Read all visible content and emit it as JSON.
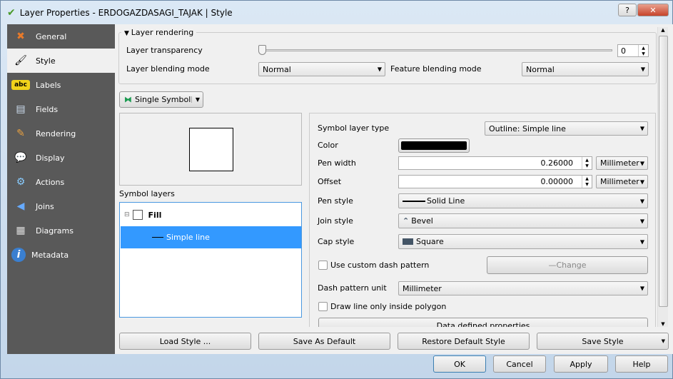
{
  "window": {
    "title": "Layer Properties - ERDOGAZDASAGI_TAJAK | Style",
    "help": "?",
    "close": "✕"
  },
  "sidebar": {
    "items": [
      {
        "label": "General",
        "icon": "wrench-screwdriver-icon",
        "glyph": "✖"
      },
      {
        "label": "Style",
        "icon": "paintbrush-icon",
        "glyph": "🖌"
      },
      {
        "label": "Labels",
        "icon": "abc-label-icon",
        "glyph": "abc"
      },
      {
        "label": "Fields",
        "icon": "table-icon",
        "glyph": "▤"
      },
      {
        "label": "Rendering",
        "icon": "brush-icon",
        "glyph": "✎"
      },
      {
        "label": "Display",
        "icon": "speech-bubble-icon",
        "glyph": "💬"
      },
      {
        "label": "Actions",
        "icon": "gear-icon",
        "glyph": "⚙"
      },
      {
        "label": "Joins",
        "icon": "join-icon",
        "glyph": "◀"
      },
      {
        "label": "Diagrams",
        "icon": "chart-icon",
        "glyph": "▦"
      },
      {
        "label": "Metadata",
        "icon": "info-icon",
        "glyph": "i"
      }
    ]
  },
  "rendering": {
    "title": "Layer rendering",
    "transparency_label": "Layer transparency",
    "transparency_value": "0",
    "transparency_percent": 0,
    "blend_label": "Layer blending mode",
    "blend_value": "Normal",
    "feature_blend_label": "Feature blending mode",
    "feature_blend_value": "Normal"
  },
  "renderer": {
    "value": "Single Symbol"
  },
  "symbol_layers": {
    "label": "Symbol layers",
    "items": [
      {
        "label": "Fill"
      },
      {
        "label": "Simple line"
      }
    ]
  },
  "props": {
    "type_label": "Symbol layer type",
    "type_value": "Outline: Simple line",
    "color_label": "Color",
    "color": "#000000",
    "pen_width_label": "Pen width",
    "pen_width": "0.26000",
    "pen_width_unit": "Millimeter",
    "offset_label": "Offset",
    "offset": "0.00000",
    "offset_unit": "Millimeter",
    "pen_style_label": "Pen style",
    "pen_style": "Solid Line",
    "join_style_label": "Join style",
    "join_style": "Bevel",
    "cap_style_label": "Cap style",
    "cap_style": "Square",
    "custom_dash_label": "Use custom dash pattern",
    "change_label": "Change",
    "dash_unit_label": "Dash pattern unit",
    "dash_unit": "Millimeter",
    "inside_label": "Draw line only inside polygon",
    "data_defined_label": "Data defined properties"
  },
  "style_buttons": {
    "load": "Load Style ...",
    "save_default": "Save As Default",
    "restore": "Restore Default Style",
    "save": "Save Style"
  },
  "dialog_buttons": {
    "ok": "OK",
    "cancel": "Cancel",
    "apply": "Apply",
    "help": "Help"
  }
}
